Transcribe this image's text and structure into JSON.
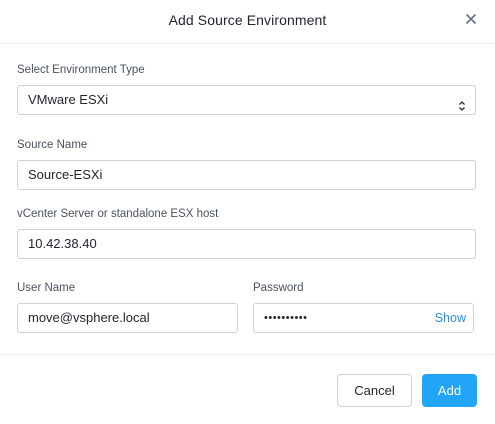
{
  "dialog": {
    "title": "Add Source Environment"
  },
  "form": {
    "env_type": {
      "label": "Select Environment Type",
      "value": "VMware ESXi"
    },
    "source_name": {
      "label": "Source Name",
      "value": "Source-ESXi"
    },
    "host": {
      "label": "vCenter Server or standalone ESX host",
      "value": "10.42.38.40"
    },
    "user_name": {
      "label": "User Name",
      "value": "move@vsphere.local"
    },
    "password": {
      "label": "Password",
      "masked_value": "••••••••••",
      "show_label": "Show"
    }
  },
  "footer": {
    "cancel_label": "Cancel",
    "add_label": "Add"
  },
  "colors": {
    "accent": "#22a5f7",
    "link": "#2a8ee0",
    "border": "#ccd2da"
  },
  "icons": {
    "close": "close-icon",
    "select": "select-caret-icon"
  }
}
